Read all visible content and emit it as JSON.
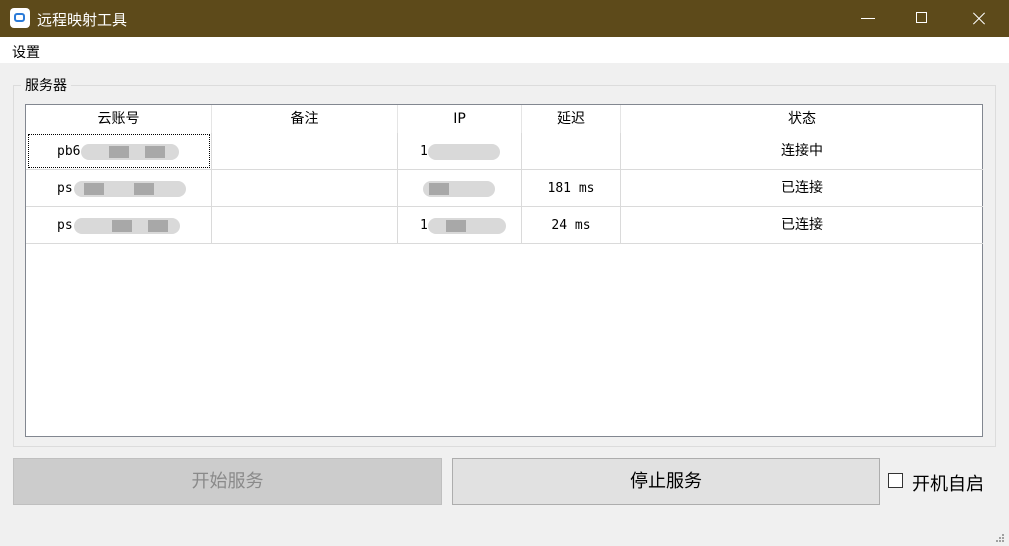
{
  "window": {
    "title": "远程映射工具",
    "titlebar_color": "#5d4a1a"
  },
  "menu": {
    "settings": "设置"
  },
  "group": {
    "title": "服务器"
  },
  "table": {
    "columns": [
      "云账号",
      "备注",
      "IP",
      "延迟",
      "状态"
    ],
    "rows": [
      {
        "account": "pb6",
        "note": "",
        "ip": "1",
        "latency": "",
        "status": "连接中"
      },
      {
        "account": "ps",
        "note": "",
        "ip": "",
        "latency": "181 ms",
        "status": "已连接"
      },
      {
        "account": "ps",
        "note": "",
        "ip": "1",
        "latency": "24 ms",
        "status": "已连接"
      }
    ]
  },
  "buttons": {
    "start": "开始服务",
    "stop": "停止服务"
  },
  "autostart": {
    "label": "开机自启",
    "checked": false
  }
}
